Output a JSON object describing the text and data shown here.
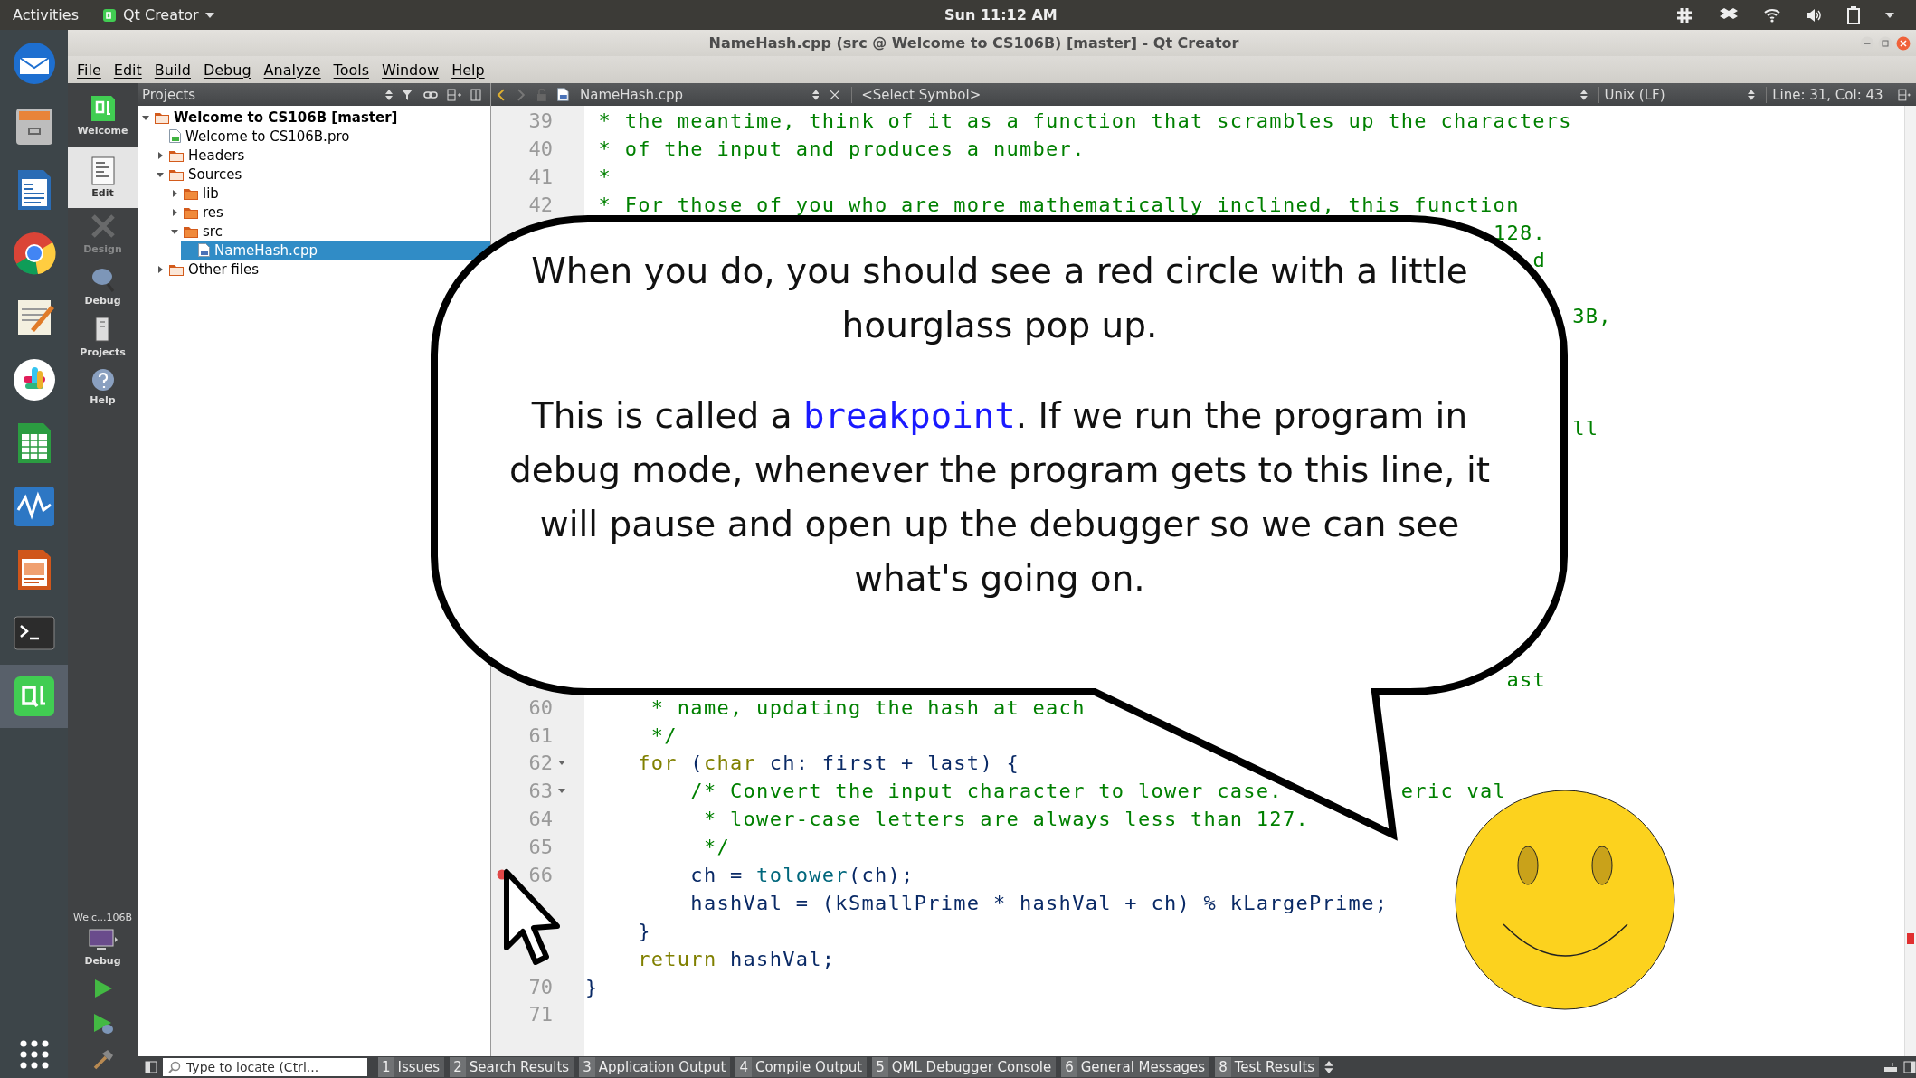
{
  "top_bar": {
    "activities": "Activities",
    "app_menu": "Qt Creator",
    "clock": "Sun 11:12 AM"
  },
  "window": {
    "title": "NameHash.cpp (src @ Welcome to CS106B) [master] - Qt Creator"
  },
  "menu": [
    "File",
    "Edit",
    "Build",
    "Debug",
    "Analyze",
    "Tools",
    "Window",
    "Help"
  ],
  "modes": [
    {
      "label": "Welcome",
      "selected": false,
      "disabled": false
    },
    {
      "label": "Edit",
      "selected": true,
      "disabled": false
    },
    {
      "label": "Design",
      "selected": false,
      "disabled": true
    },
    {
      "label": "Debug",
      "selected": false,
      "disabled": false
    },
    {
      "label": "Projects",
      "selected": false,
      "disabled": false
    },
    {
      "label": "Help",
      "selected": false,
      "disabled": false
    }
  ],
  "kit": {
    "project": "Welc...106B",
    "config": "Debug"
  },
  "projects": {
    "title": "Projects",
    "tree": [
      {
        "label": "Welcome to CS106B [master]",
        "kind": "project",
        "expanded": true,
        "selected": false,
        "children": [
          {
            "label": "Welcome to CS106B.pro",
            "kind": "profile",
            "selected": false
          },
          {
            "label": "Headers",
            "kind": "headers",
            "expanded": false,
            "selected": false
          },
          {
            "label": "Sources",
            "kind": "sources",
            "expanded": true,
            "selected": false,
            "children": [
              {
                "label": "lib",
                "kind": "folder",
                "expanded": false,
                "selected": false
              },
              {
                "label": "res",
                "kind": "folder",
                "expanded": false,
                "selected": false
              },
              {
                "label": "src",
                "kind": "folder",
                "expanded": true,
                "selected": false,
                "children": [
                  {
                    "label": "NameHash.cpp",
                    "kind": "cpp",
                    "selected": true
                  }
                ]
              }
            ]
          },
          {
            "label": "Other files",
            "kind": "other",
            "expanded": false,
            "selected": false
          }
        ]
      }
    ]
  },
  "editor": {
    "file": "NameHash.cpp",
    "symbol": "<Select Symbol>",
    "line_ending": "Unix (LF)",
    "position": "Line: 31, Col: 43",
    "lines_above": [
      {
        "number": "39",
        "fold": false,
        "breakpoint": false,
        "segments": [
          {
            "text": " * the meantime, think of it as a function that scrambles up the characters",
            "kind": "comment"
          }
        ]
      },
      {
        "number": "40",
        "fold": false,
        "breakpoint": false,
        "segments": [
          {
            "text": " * of the input and produces a number.",
            "kind": "comment"
          }
        ]
      },
      {
        "number": "41",
        "fold": false,
        "breakpoint": false,
        "segments": [
          {
            "text": " *",
            "kind": "comment"
          }
        ]
      },
      {
        "number": "42",
        "fold": false,
        "breakpoint": false,
        "segments": [
          {
            "text": " * For those of you who are more mathematically inclined, this function",
            "kind": "comment"
          }
        ]
      }
    ],
    "covered_fragments": [
      "128.",
      "d",
      "3B,",
      "ll",
      "ast"
    ],
    "lines_below": [
      {
        "number": "60",
        "fold": false,
        "breakpoint": false,
        "segments": [
          {
            "text": "     * name, updating the hash at each",
            "kind": "comment"
          }
        ]
      },
      {
        "number": "61",
        "fold": false,
        "breakpoint": false,
        "segments": [
          {
            "text": "     */",
            "kind": "comment"
          }
        ]
      },
      {
        "number": "62",
        "fold": true,
        "breakpoint": false,
        "segments": [
          {
            "text": "    for",
            "kind": "keyword"
          },
          {
            "text": " (",
            "kind": "code"
          },
          {
            "text": "char",
            "kind": "keyword"
          },
          {
            "text": " ch: first + last) {",
            "kind": "code"
          }
        ]
      },
      {
        "number": "63",
        "fold": true,
        "breakpoint": false,
        "segments": [
          {
            "text": "        /* Convert the input character to lower case.",
            "kind": "comment"
          },
          {
            "text": "         eric val",
            "kind": "comment"
          }
        ]
      },
      {
        "number": "64",
        "fold": false,
        "breakpoint": false,
        "segments": [
          {
            "text": "         * lower-case letters are always less than 127.",
            "kind": "comment"
          }
        ]
      },
      {
        "number": "65",
        "fold": false,
        "breakpoint": false,
        "segments": [
          {
            "text": "         */",
            "kind": "comment"
          }
        ]
      },
      {
        "number": "66",
        "fold": false,
        "breakpoint": true,
        "segments": [
          {
            "text": "        ch = ",
            "kind": "code"
          },
          {
            "text": "tolower",
            "kind": "function"
          },
          {
            "text": "(ch);",
            "kind": "code"
          }
        ]
      },
      {
        "segments": [
          {
            "text": "        hashVal = (kSmallPrime * hashVal + ch) % kLargePrime;",
            "kind": "code"
          }
        ]
      },
      {
        "segments": [
          {
            "text": "    }",
            "kind": "code"
          }
        ]
      },
      {
        "segments": [
          {
            "text": "    return",
            "kind": "keyword"
          },
          {
            "text": " hashVal;",
            "kind": "code"
          }
        ]
      },
      {
        "number": "70",
        "fold": false,
        "breakpoint": false,
        "segments": [
          {
            "text": "}",
            "kind": "code"
          }
        ]
      },
      {
        "number": "71",
        "fold": false,
        "breakpoint": false
      }
    ]
  },
  "callout": {
    "paragraphs": [
      "When you do, you should see a red circle with a little hourglass pop up.",
      "This is called a **breakpoint**. If we run the program in debug mode, whenever the program gets to this line, it will pause and open up the debugger so we can see what's going on."
    ]
  },
  "status_bar": {
    "locator_placeholder": "Type to locate (Ctrl...",
    "panes": [
      {
        "number": "1",
        "label": "Issues"
      },
      {
        "number": "2",
        "label": "Search Results"
      },
      {
        "number": "3",
        "label": "Application Output"
      },
      {
        "number": "4",
        "label": "Compile Output"
      },
      {
        "number": "5",
        "label": "QML Debugger Console"
      },
      {
        "number": "6",
        "label": "General Messages"
      },
      {
        "number": "8",
        "label": "Test Results"
      }
    ]
  }
}
